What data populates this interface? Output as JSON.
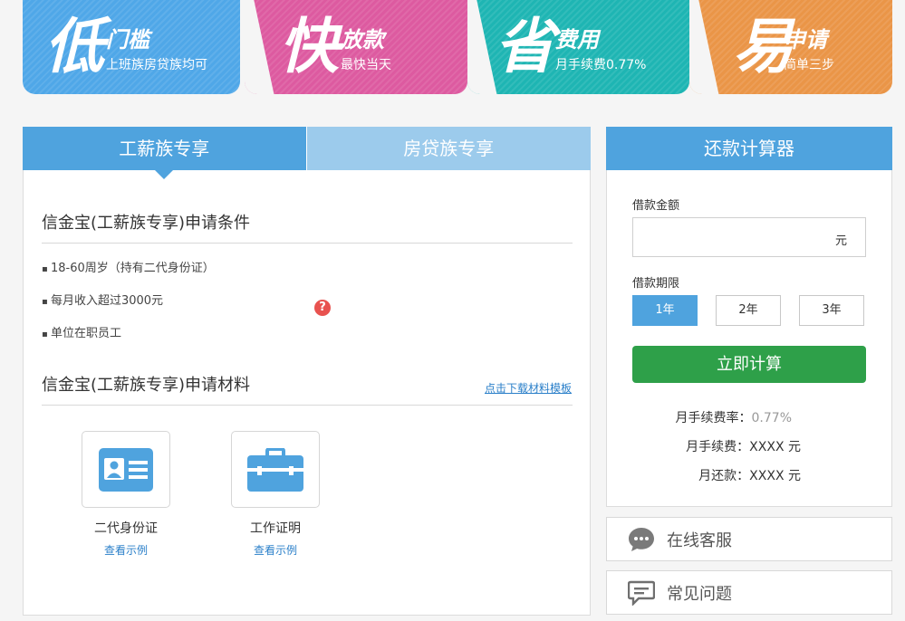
{
  "banners": [
    {
      "big": "低",
      "title": "门槛",
      "sub": "上班族房贷族均可"
    },
    {
      "big": "快",
      "title": "放款",
      "sub": "最快当天"
    },
    {
      "big": "省",
      "title": "费用",
      "sub": "月手续费0.77%"
    },
    {
      "big": "易",
      "title": "申请",
      "sub": "简单三步"
    }
  ],
  "tabs": {
    "active": "工薪族专享",
    "inactive": "房贷族专享"
  },
  "conditions": {
    "title": "信金宝(工薪族专享)申请条件",
    "items": [
      "18-60周岁（持有二代身份证）",
      "每月收入超过3000元",
      "单位在职员工"
    ],
    "help_icon": "?"
  },
  "materials": {
    "title": "信金宝(工薪族专享)申请材料",
    "download_link": "点击下载材料模板",
    "docs": [
      {
        "label": "二代身份证",
        "link": "查看示例",
        "icon": "id-card-icon"
      },
      {
        "label": "工作证明",
        "link": "查看示例",
        "icon": "briefcase-icon"
      }
    ]
  },
  "calculator": {
    "title": "还款计算器",
    "amount_label": "借款金额",
    "amount_value": "",
    "amount_unit": "元",
    "term_label": "借款期限",
    "terms": [
      "1年",
      "2年",
      "3年"
    ],
    "selected_term": "1年",
    "calc_button": "立即计算",
    "rate_label": "月手续费率：",
    "rate_value": "0.77%",
    "fee_label": "月手续费：",
    "fee_value": "XXXX 元",
    "repay_label": "月还款：",
    "repay_value": "XXXX 元"
  },
  "side_links": {
    "online_service": "在线客服",
    "faq": "常见问题"
  },
  "colors": {
    "blue": "#4fa7e8",
    "pink": "#dd5aa0",
    "teal": "#1eb5b3",
    "orange": "#ea9547",
    "tab_active": "#4fa3de",
    "tab_inactive": "#9ccbec",
    "green_button": "#2ea049",
    "link": "#2a7fc9"
  }
}
